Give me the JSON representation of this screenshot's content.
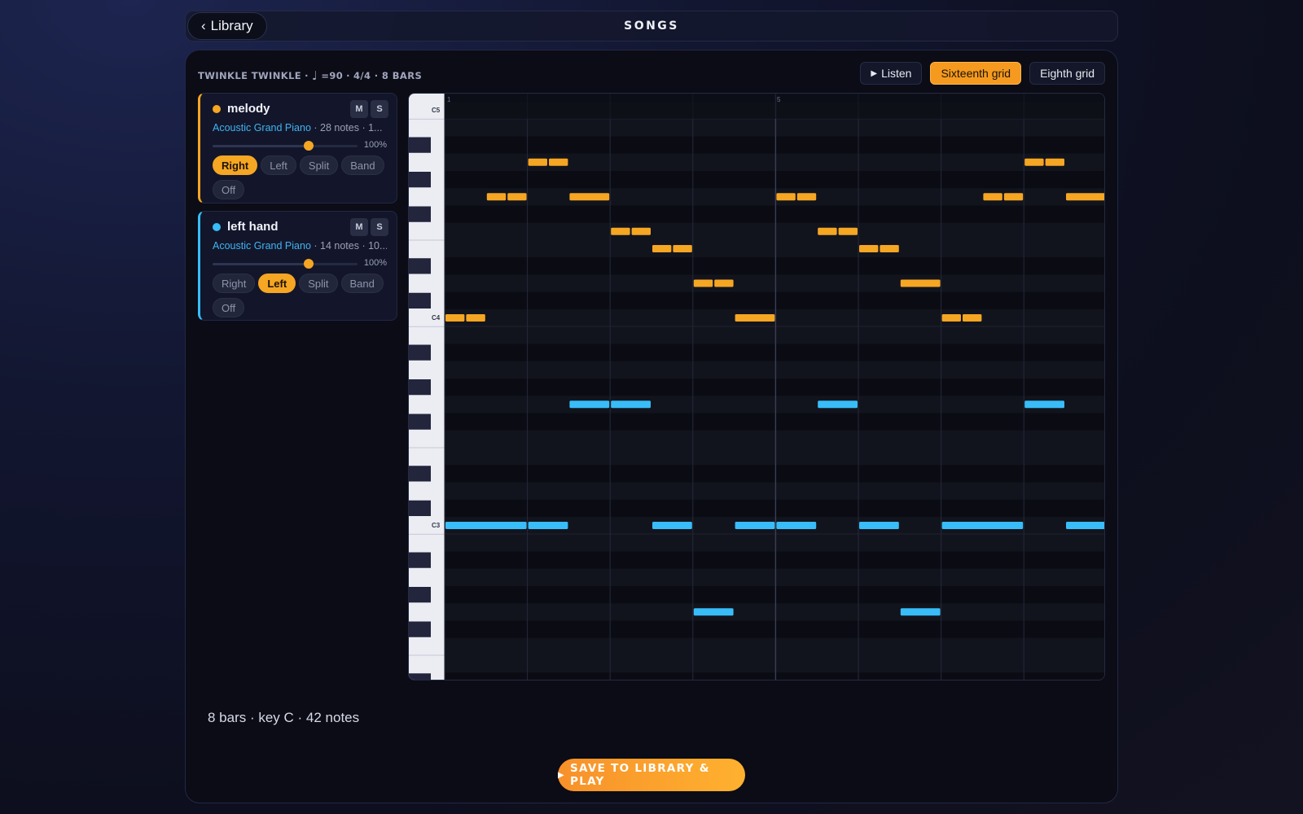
{
  "header": {
    "back_label": "Library",
    "title": "SONGS"
  },
  "song": {
    "title": "TWINKLE TWINKLE",
    "tempo": "=90",
    "meta": "4/4 · 8 BARS"
  },
  "toolbar": {
    "listen_label": "Listen",
    "sixteenth_label": "Sixteenth grid",
    "eighth_label": "Eighth grid",
    "active_grid": "sixteenth"
  },
  "tracks": [
    {
      "name": "melody",
      "color": "#f5a623",
      "instrument": "Acoustic Grand Piano",
      "details": "· 28 notes · 1...",
      "volume_pct": "100%",
      "volume": 0.66,
      "mute_label": "M",
      "solo_label": "S",
      "hands": [
        "Right",
        "Left",
        "Split",
        "Band",
        "Off"
      ],
      "active_hand": "Right"
    },
    {
      "name": "left hand",
      "color": "#38bdf8",
      "instrument": "Acoustic Grand Piano",
      "details": "· 14 notes · 10...",
      "volume_pct": "100%",
      "volume": 0.66,
      "mute_label": "M",
      "solo_label": "S",
      "hands": [
        "Right",
        "Left",
        "Split",
        "Band",
        "Off"
      ],
      "active_hand": "Left"
    }
  ],
  "roll": {
    "key_labels": {
      "c5": "C5",
      "c4": "C4",
      "c3": "C3"
    },
    "bar_labels": {
      "bar1": "1",
      "bar5": "5"
    },
    "melody_notes": [
      {
        "p": 60,
        "s": 0,
        "d": 2
      },
      {
        "p": 60,
        "s": 2,
        "d": 2
      },
      {
        "p": 67,
        "s": 4,
        "d": 2
      },
      {
        "p": 67,
        "s": 6,
        "d": 2
      },
      {
        "p": 69,
        "s": 8,
        "d": 2
      },
      {
        "p": 69,
        "s": 10,
        "d": 2
      },
      {
        "p": 67,
        "s": 12,
        "d": 4
      },
      {
        "p": 65,
        "s": 16,
        "d": 2
      },
      {
        "p": 65,
        "s": 18,
        "d": 2
      },
      {
        "p": 64,
        "s": 20,
        "d": 2
      },
      {
        "p": 64,
        "s": 22,
        "d": 2
      },
      {
        "p": 62,
        "s": 24,
        "d": 2
      },
      {
        "p": 62,
        "s": 26,
        "d": 2
      },
      {
        "p": 60,
        "s": 28,
        "d": 4
      },
      {
        "p": 67,
        "s": 32,
        "d": 2
      },
      {
        "p": 67,
        "s": 34,
        "d": 2
      },
      {
        "p": 65,
        "s": 36,
        "d": 2
      },
      {
        "p": 65,
        "s": 38,
        "d": 2
      },
      {
        "p": 64,
        "s": 40,
        "d": 2
      },
      {
        "p": 64,
        "s": 42,
        "d": 2
      },
      {
        "p": 62,
        "s": 44,
        "d": 4
      },
      {
        "p": 60,
        "s": 48,
        "d": 2
      },
      {
        "p": 60,
        "s": 50,
        "d": 2
      },
      {
        "p": 67,
        "s": 52,
        "d": 2
      },
      {
        "p": 67,
        "s": 54,
        "d": 2
      },
      {
        "p": 69,
        "s": 56,
        "d": 2
      },
      {
        "p": 69,
        "s": 58,
        "d": 2
      },
      {
        "p": 67,
        "s": 60,
        "d": 4
      }
    ],
    "left_notes": [
      {
        "p": 48,
        "s": 0,
        "d": 8
      },
      {
        "p": 48,
        "s": 8,
        "d": 4
      },
      {
        "p": 55,
        "s": 12,
        "d": 4
      },
      {
        "p": 55,
        "s": 16,
        "d": 4
      },
      {
        "p": 48,
        "s": 20,
        "d": 4
      },
      {
        "p": 43,
        "s": 24,
        "d": 4
      },
      {
        "p": 48,
        "s": 28,
        "d": 4
      },
      {
        "p": 48,
        "s": 32,
        "d": 4
      },
      {
        "p": 55,
        "s": 36,
        "d": 4
      },
      {
        "p": 48,
        "s": 40,
        "d": 4
      },
      {
        "p": 43,
        "s": 44,
        "d": 4
      },
      {
        "p": 48,
        "s": 48,
        "d": 8
      },
      {
        "p": 55,
        "s": 56,
        "d": 4
      },
      {
        "p": 48,
        "s": 60,
        "d": 4
      }
    ]
  },
  "footer": {
    "summary": "8 bars · key C · 42 notes",
    "save_label": "SAVE TO LIBRARY & PLAY"
  }
}
